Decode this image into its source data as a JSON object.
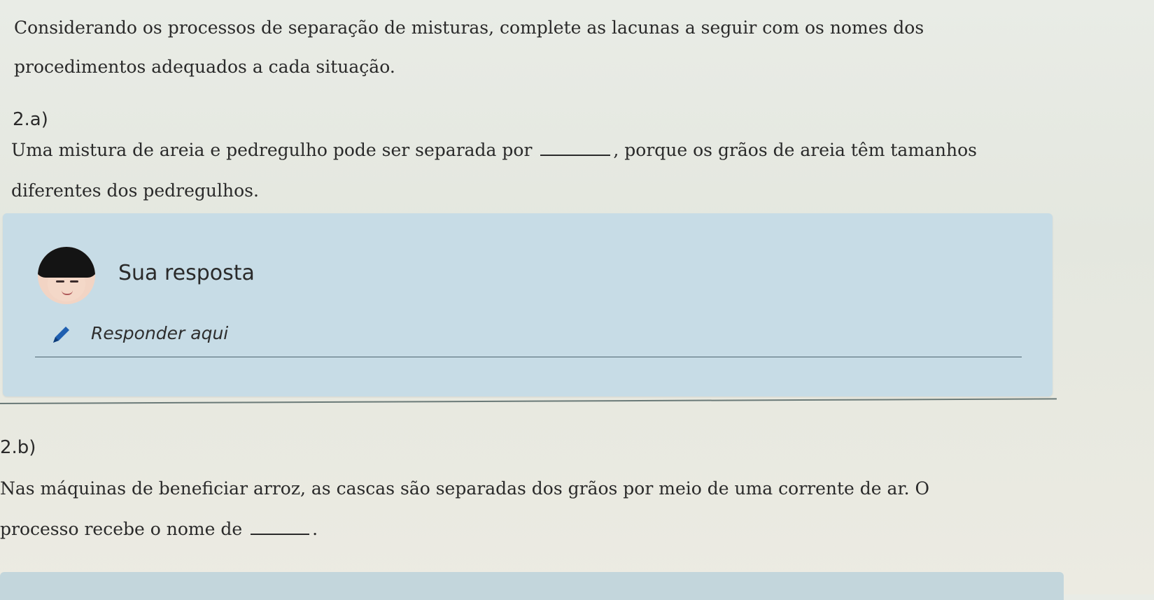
{
  "intro": {
    "text": "Considerando os processos de separação de misturas, complete as lacunas a seguir com os nomes dos procedimentos adequados a cada situação."
  },
  "questions": [
    {
      "label": "2.a)",
      "text_before": "Uma mistura de areia e pedregulho pode ser separada por",
      "text_after": ", porque os grãos de areia têm tamanhos diferentes dos pedregulhos."
    },
    {
      "label": "2.b)",
      "text_before": "Nas máquinas de beneficiar arroz, as cascas são separadas dos grãos por meio de uma corrente de ar. O processo recebe o nome de",
      "text_after": "."
    }
  ],
  "answer_card": {
    "title": "Sua resposta",
    "placeholder": "Responder aqui",
    "value": "",
    "avatar_icon": "user-avatar",
    "pencil_icon": "pencil-icon",
    "card_color": "#c7dce6"
  }
}
